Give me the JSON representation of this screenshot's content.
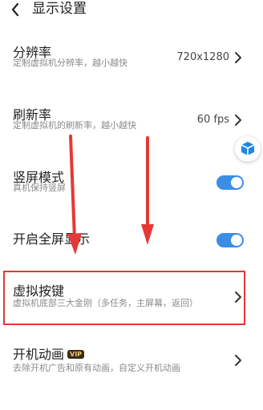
{
  "header": {
    "title": "显示设置"
  },
  "settings": {
    "resolution": {
      "title": "分辨率",
      "subtitle": "定制虚拟机分辨率，越小越快",
      "value": "720x1280"
    },
    "refresh_rate": {
      "title": "刷新率",
      "subtitle": "定制虚拟机的刷新率，越小越快",
      "value": "60 fps"
    },
    "portrait": {
      "title": "竖屏模式",
      "subtitle": "真机保持竖屏",
      "enabled": true
    },
    "fullscreen": {
      "title": "开启全屏显示",
      "enabled": true
    },
    "virtual_keys": {
      "title": "虚拟按键",
      "subtitle": "虚拟机底部三大金刚（多任务，主屏幕，返回）"
    },
    "boot_animation": {
      "title": "开机动画",
      "badge": "VIP",
      "subtitle": "去除开机广告和原有动画，自定义开机动画"
    }
  },
  "colors": {
    "accent": "#3a8ee6",
    "highlight_box": "#e53935",
    "arrow": "#e53935"
  }
}
